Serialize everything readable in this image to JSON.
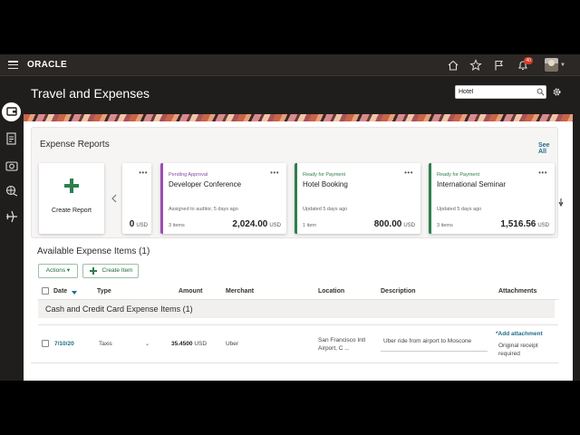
{
  "topbar": {
    "logo": "ORACLE",
    "notification_count": "40"
  },
  "page": {
    "title": "Travel and Expenses",
    "search_value": "Hotel"
  },
  "expense_reports": {
    "title": "Expense Reports",
    "see_all": "See All",
    "create_label": "Create Report",
    "partial_card": {
      "amount": "0",
      "currency": "USD"
    },
    "cards": [
      {
        "status": "Pending Approval",
        "title": "Developer Conference",
        "meta": "Assigned to auditor, 5 days ago",
        "items": "3 items",
        "amount": "2,024.00",
        "currency": "USD"
      },
      {
        "status": "Ready for Payment",
        "title": "Hotel Booking",
        "meta": "Updated 5 days ago",
        "items": "1 item",
        "amount": "800.00",
        "currency": "USD"
      },
      {
        "status": "Ready for Payment",
        "title": "International Seminar",
        "meta": "Updated 5 days ago",
        "items": "3 items",
        "amount": "1,516.56",
        "currency": "USD"
      }
    ]
  },
  "available_items": {
    "title": "Available Expense Items  (1)",
    "actions_label": "Actions",
    "create_item_label": "Create Item",
    "columns": [
      "Date",
      "Type",
      "Amount",
      "Merchant",
      "Location",
      "Description",
      "Attachments"
    ],
    "group_title": "Cash and Credit Card Expense Items  (1)",
    "rows": [
      {
        "date": "7/10/20",
        "type": "Taxis",
        "amount": "35.4500",
        "currency": "USD",
        "merchant": "Uber",
        "location_line1": "San Francisco Intl",
        "location_line2": "Airport, C ...",
        "description": "Uber ride from airport to Moscone",
        "attachment_link": "*Add attachment",
        "attachment_note1": "Original receipt",
        "attachment_note2": "required"
      }
    ]
  },
  "colors": {
    "accent_green": "#2f7e4d",
    "pending_purple": "#9b4fb0",
    "link_teal": "#1f6c87",
    "header_bg": "#201e1c"
  }
}
